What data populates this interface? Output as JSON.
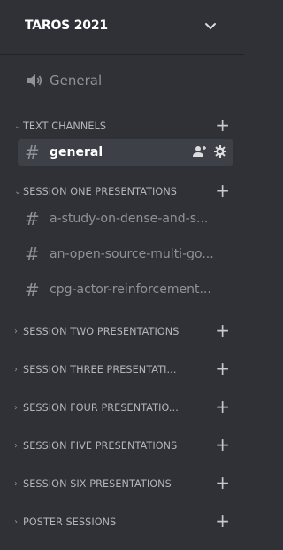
{
  "server": {
    "name": "TAROS 2021"
  },
  "voice_channel": {
    "label": "General"
  },
  "categories": [
    {
      "label": "TEXT CHANNELS",
      "expanded": true
    },
    {
      "label": "SESSION ONE PRESENTATIONS",
      "expanded": true
    },
    {
      "label": "SESSION TWO PRESENTATIONS",
      "expanded": false
    },
    {
      "label": "SESSION THREE PRESENTATI...",
      "expanded": false
    },
    {
      "label": "SESSION FOUR PRESENTATIO...",
      "expanded": false
    },
    {
      "label": "SESSION FIVE PRESENTATIONS",
      "expanded": false
    },
    {
      "label": "SESSION SIX PRESENTATIONS",
      "expanded": false
    },
    {
      "label": "POSTER SESSIONS",
      "expanded": false
    }
  ],
  "text_channels": [
    {
      "label": "general",
      "selected": true
    }
  ],
  "session_one_channels": [
    {
      "label": "a-study-on-dense-and-s..."
    },
    {
      "label": "an-open-source-multi-go..."
    },
    {
      "label": "cpg-actor-reinforcement..."
    }
  ],
  "icons": {
    "header": "chevron-down-icon",
    "voice": "speaker-icon",
    "channel": "hash-icon",
    "invite": "add-member-icon",
    "settings": "gear-icon",
    "add": "plus-icon",
    "collapse": "chevron-icon"
  },
  "colors": {
    "background": "#2f3136",
    "selected": "#3d4046",
    "text_muted": "#8e9297",
    "text_active": "#ffffff"
  }
}
